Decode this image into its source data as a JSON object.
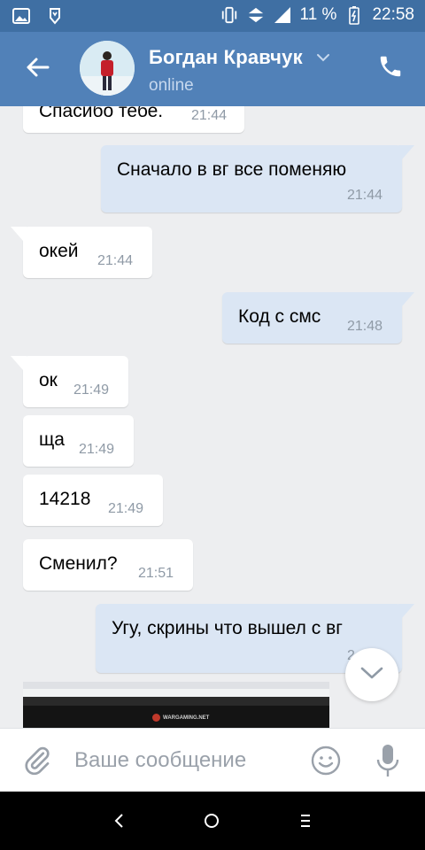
{
  "status_bar": {
    "battery_text": "11 %",
    "time": "22:58",
    "icons": [
      "gallery-icon",
      "vk-notification-icon",
      "vibrate-icon",
      "data-arrows-icon",
      "signal-icon",
      "battery-charging-icon"
    ]
  },
  "header": {
    "peer_name": "Богдан Кравчук",
    "peer_status": "online",
    "icons": [
      "back-arrow-icon",
      "chevron-down-icon",
      "phone-icon"
    ]
  },
  "messages": [
    {
      "dir": "in",
      "text": "Спасибо тебе.",
      "time": "21:44"
    },
    {
      "dir": "out",
      "text": "Сначало в вг все поменяю",
      "time": "21:44"
    },
    {
      "dir": "in",
      "text": "окей",
      "time": "21:44"
    },
    {
      "dir": "out",
      "text": "Код с смс",
      "time": "21:48"
    },
    {
      "dir": "in",
      "text": "ок",
      "time": "21:49"
    },
    {
      "dir": "in",
      "text": "ща",
      "time": "21:49"
    },
    {
      "dir": "in",
      "text": "14218",
      "time": "21:49"
    },
    {
      "dir": "in",
      "text": "Сменил?",
      "time": "21:51"
    },
    {
      "dir": "out",
      "text": "Угу, скрины что вышел с вг",
      "time": "2"
    }
  ],
  "photo": {
    "site_label": "WARGAMING.NET"
  },
  "input": {
    "placeholder": "Ваше сообщение"
  },
  "colors": {
    "status_bar": "#3f6fa3",
    "header": "#5181b8",
    "background": "#edeef0",
    "bubble_in": "#ffffff",
    "bubble_out": "#dbe6f4",
    "timestamp": "#8f9aa6"
  }
}
